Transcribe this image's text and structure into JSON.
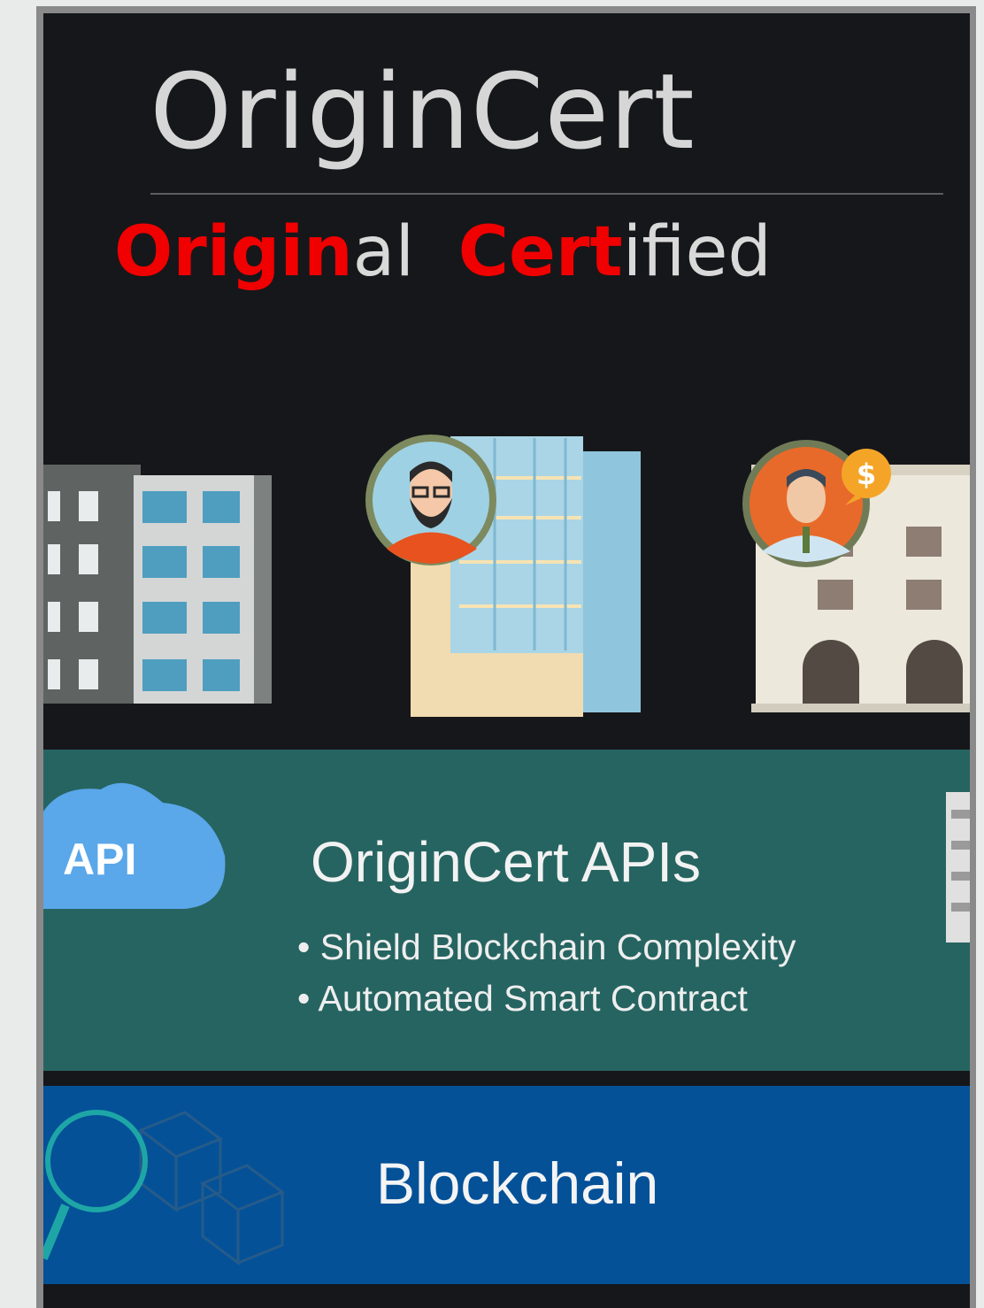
{
  "header": {
    "brand": "OriginCert",
    "tagline": {
      "p1": "Origin",
      "p2": "al",
      "p3": "Cert",
      "p4": "ified"
    }
  },
  "api_section": {
    "cloud_label": "API",
    "title": "OriginCert APIs",
    "bullets": [
      "• Shield Blockchain Complexity",
      "• Automated Smart Contract"
    ]
  },
  "blockchain_section": {
    "title": "Blockchain"
  },
  "icons": [
    "office-buildings",
    "person-avatar",
    "banker-avatar",
    "dollar-badge",
    "api-cloud",
    "magnifier-icon",
    "blocks-icon"
  ]
}
